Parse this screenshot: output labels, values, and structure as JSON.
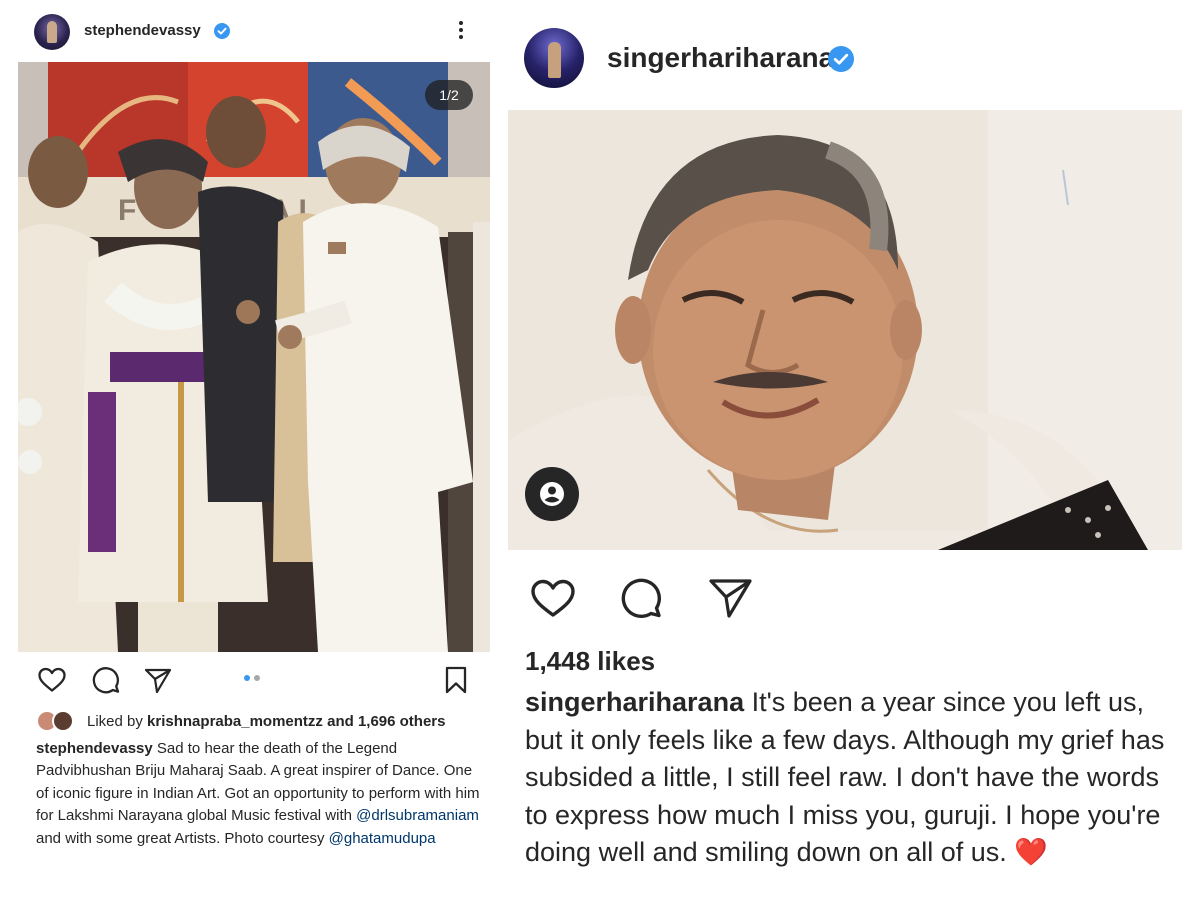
{
  "left_post": {
    "username": "stephendevassy",
    "verified": true,
    "photo_counter": "1/2",
    "photo_banner_text": "FESTIVAL",
    "carousel": {
      "count": 2,
      "active_index": 0
    },
    "liked_by": {
      "prefix": "Liked by",
      "user": "krishnapraba_momentzz",
      "suffix": "and 1,696 others"
    },
    "caption": {
      "author": "stephendevassy",
      "text_1": "Sad to hear the death of the Legend Padvibhushan Briju Maharaj Saab.  A great inspirer of Dance. One of iconic figure in Indian Art. Got an opportunity to perform with him for Lakshmi Narayana global Music festival with ",
      "mention_1": "@drlsubramaniam",
      "text_2": " and with some great Artists. Photo courtesy ",
      "mention_2": "@ghatamudupa"
    },
    "icons": {
      "more": "more-vertical-icon",
      "like": "heart-icon",
      "comment": "comment-icon",
      "share": "send-icon",
      "save": "bookmark-icon"
    }
  },
  "right_post": {
    "username": "singerhariharana",
    "verified": true,
    "likes": "1,448 likes",
    "caption": {
      "author": "singerhariharana",
      "text": " It's been a year since you left us, but it only feels like a few days. Although my grief has subsided a little, I still feel raw. I don't have the words to express how much I miss you, guruji. I hope you're doing well and smiling down on all of us. ",
      "emoji": "❤️"
    },
    "icons": {
      "tag": "user-tag-icon",
      "like": "heart-icon",
      "comment": "comment-icon",
      "share": "send-icon"
    }
  },
  "colors": {
    "text": "#262626",
    "verified_badge": "#3897f0",
    "mention": "#00376b",
    "carousel_active": "#3897f0",
    "carousel_inactive": "#a8a8a8",
    "heart_emoji": "#e0242f"
  }
}
